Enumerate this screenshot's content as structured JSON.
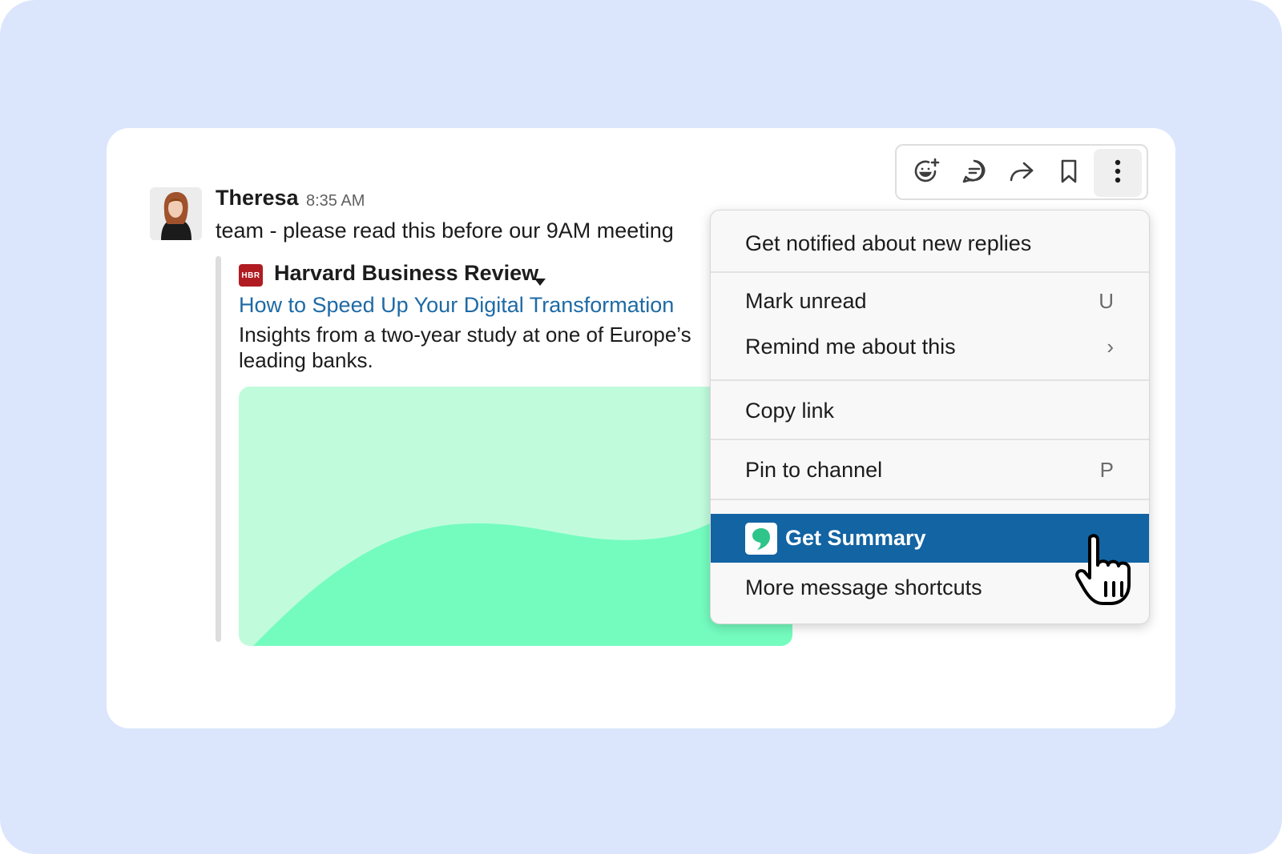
{
  "message": {
    "sender": "Theresa",
    "time": "8:35 AM",
    "text": "team - please read this before our 9AM meeting"
  },
  "attachment": {
    "source_logo_text": "HBR",
    "source_name": "Harvard Business Review",
    "title": "How to Speed Up Your Digital Transformation",
    "description": "Insights from a two-year study at one of Europe’s leading banks."
  },
  "toolbar": {
    "icons": [
      "add-reaction-icon",
      "reply-in-thread-icon",
      "share-icon",
      "bookmark-icon",
      "more-actions-icon"
    ]
  },
  "menu": {
    "items": [
      {
        "label": "Get notified about new replies",
        "shortcut": ""
      },
      {
        "label": "Mark unread",
        "shortcut": "U"
      },
      {
        "label": "Remind me about this",
        "shortcut": "›"
      },
      {
        "label": "Copy link",
        "shortcut": ""
      },
      {
        "label": "Pin to channel",
        "shortcut": "P"
      },
      {
        "label": "Get Summary",
        "shortcut": ""
      },
      {
        "label": "More message shortcuts",
        "shortcut": ""
      }
    ]
  },
  "colors": {
    "background": "#dbe6fd",
    "link": "#1d6aa5",
    "highlight": "#1264a3",
    "preview_light": "#c0fcdc",
    "preview_dark": "#74fcbe",
    "hbr_red": "#b01c22",
    "app_green": "#2fc48a"
  }
}
